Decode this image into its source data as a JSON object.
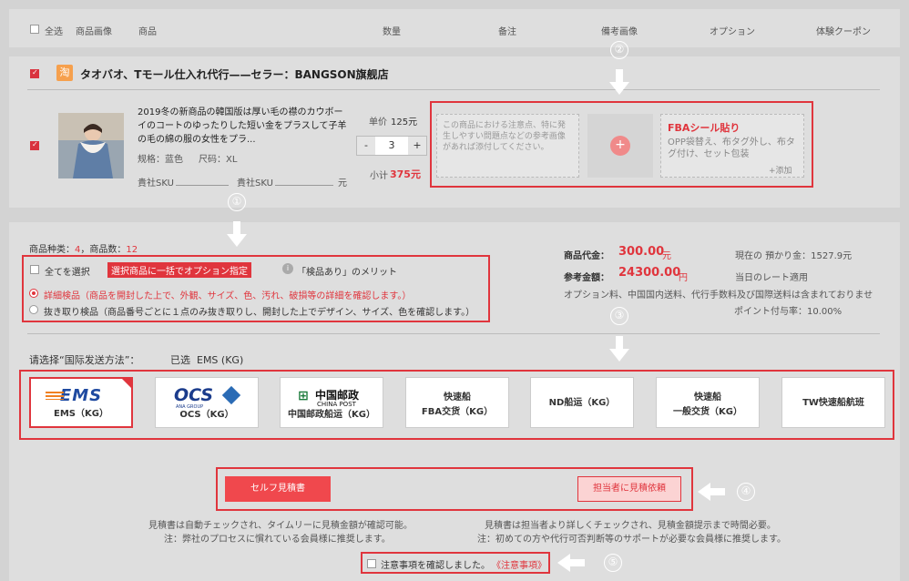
{
  "header": {
    "select_all": "全选",
    "col_image": "商品画像",
    "col_product": "商品",
    "col_qty": "数量",
    "col_notes": "备注",
    "col_notes_image": "備考画像",
    "col_option": "オプション",
    "col_coupon": "体験クーポン"
  },
  "store": {
    "badge": "淘",
    "name": "タオバオ、Tモール仕入れ代行——セラー：BANGSON旗舰店"
  },
  "product": {
    "title": "2019冬の新商品の韓国版は厚い毛の襟のカウボーイのコートのゆったりした短い金をプラスして子羊の毛の綿の服の女性をプラ...",
    "color_label": "规格：蓝色",
    "size_label": "尺码：XL",
    "sku_label1": "貴社SKU",
    "sku_label2": "貴社SKU",
    "yen": "元",
    "unit_price_label": "单价",
    "unit_price": "125元",
    "qty_minus": "-",
    "qty_value": "3",
    "qty_plus": "+",
    "subtotal_label": "小计",
    "subtotal": "375元",
    "notes_placeholder": "この商品における注意点、特に発生しやすい問題点などの参考画像があれば添付してください。",
    "add_image": "+",
    "option_title": "FBAシール貼り",
    "option_desc": "OPP袋替え、布タグ外し、布タグ付け、セット包装",
    "option_add": "+添加"
  },
  "summary": {
    "kinds_label": "商品种类：",
    "kinds_value": "4",
    "count_label": "，商品数：",
    "count_value": "12",
    "select_all": "全てを選択",
    "bulk_option": "選択商品に一括でオプション指定",
    "info_icon": "i",
    "merit": "「検品あり」のメリット",
    "inspect_detail": "詳細検品（商品を開封した上で、外観、サイズ、色、汚れ、破損等の詳細を確認します。）",
    "inspect_sample": "抜き取り検品（商品番号ごとに１点のみ抜き取りし、開封した上でデザイン、サイズ、色を確認します。）",
    "goods_price_label": "商品代金：",
    "goods_price": "300.00",
    "goods_price_unit": "元",
    "ref_amount_label": "参考金額：",
    "ref_amount": "24300.00",
    "ref_amount_unit": "円",
    "deposit": "現在の 預かり金：1527.9元",
    "rate_note": "当日のレート適用",
    "fee_note": "オプション料、中国国内送料、代行手数料及び国際送料は含まれておりませ",
    "points": "ポイント付与率：10.00%"
  },
  "shipping": {
    "prompt": "请选择“国际发送方法”：",
    "selected": "已选  EMS (KG)",
    "methods": [
      {
        "logo": "EMS",
        "label": "EMS（KG）"
      },
      {
        "logo": "OCS",
        "logo_sub": "ANA GROUP",
        "label": "OCS（KG）"
      },
      {
        "logo": "中国邮政",
        "logo_sub": "CHINA POST",
        "label": "中国邮政船运（KG）"
      },
      {
        "line1": "快速船",
        "line2": "FBA交货（KG）"
      },
      {
        "line1": "ND船运（KG）"
      },
      {
        "line1": "快速船",
        "line2": "一般交货（KG）"
      },
      {
        "line1": "TW快速船航班"
      }
    ]
  },
  "quote": {
    "self_button": "セルフ見積書",
    "staff_button": "担当者に見積依頼",
    "self_note1": "見積書は自動チェックされ、タイムリーに見積金額が確認可能。",
    "self_note2": "注：弊社のプロセスに慣れている会員様に推奨します。",
    "staff_note1": "見積書は担当者より詳しくチェックされ、見積金額提示まで時間必要。",
    "staff_note2": "注：初めての方や代行可否判断等のサポートが必要な会員様に推奨します。",
    "confirm_text": "注意事項を確認しました。",
    "confirm_link": "《注意事項》"
  },
  "markers": [
    "①",
    "②",
    "③",
    "④",
    "⑤"
  ]
}
